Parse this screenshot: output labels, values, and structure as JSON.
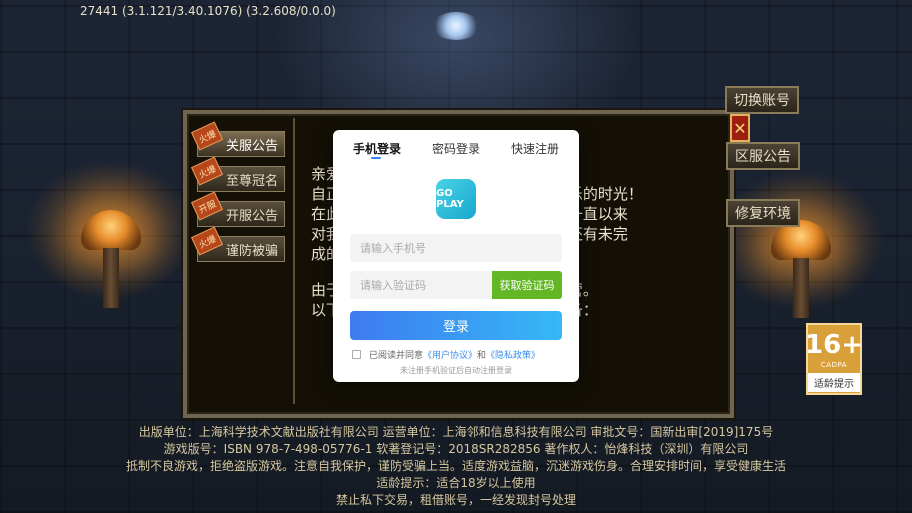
{
  "version": "27441 (3.1.121/3.40.1076) (3.2.608/0.0.0)",
  "notice_tabs": [
    {
      "label": "关服公告",
      "tag": "火爆",
      "active": true
    },
    {
      "label": "至尊冠名",
      "tag": "火爆",
      "active": false
    },
    {
      "label": "开服公告",
      "tag": "开服",
      "active": false
    },
    {
      "label": "谨防被骗",
      "tag": "火爆",
      "active": false
    }
  ],
  "notice_lines": [
    "亲爱",
    "自正                                   无数个欢乐的时光！",
    "在此                                   感谢你们一直以来",
    "对我                                   也许大家还有未完",
    "成的",
    "",
    "由于                                   式停止运营。",
    "以下                                   家做好准备："
  ],
  "side_buttons": {
    "switch_account": "切换账号",
    "close": "✕",
    "server_notice": "区服公告",
    "repair": "修复环境"
  },
  "age_badge": {
    "rating": "16+",
    "org": "CADPA",
    "label": "适龄提示"
  },
  "modal": {
    "tabs": [
      "手机登录",
      "密码登录",
      "快速注册"
    ],
    "active_tab": "手机登录",
    "logo_text": "GO PLAY",
    "phone_placeholder": "请输入手机号",
    "code_placeholder": "请输入验证码",
    "get_code": "获取验证码",
    "login": "登录",
    "agree_prefix": "已阅读并同意",
    "user_agreement": "《用户协议》",
    "and": "和",
    "privacy_policy": "《隐私政策》",
    "auto_register_hint": "未注册手机验证后自动注册登录"
  },
  "footer": [
    "出版单位：上海科学技术文献出版社有限公司 运营单位：上海邻和信息科技有限公司 审批文号：国新出审[2019]175号",
    "游戏版号：ISBN 978-7-498-05776-1 软著登记号：2018SR282856 著作权人：怡烽科技（深圳）有限公司",
    "抵制不良游戏，拒绝盗版游戏。注意自我保护，谨防受骗上当。适度游戏益脑，沉迷游戏伤身。合理安排时间，享受健康生活",
    "适龄提示：适合18岁以上使用",
    "禁止私下交易，租借账号，一经发现封号处理"
  ]
}
